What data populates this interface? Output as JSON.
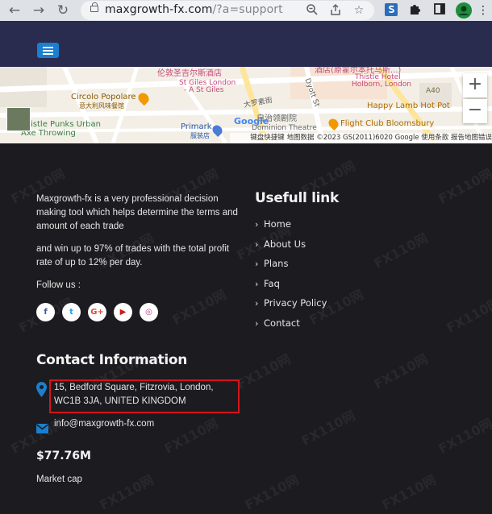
{
  "browser": {
    "url_host": "maxgrowth-fx.com",
    "url_rest": "/?a=support"
  },
  "map": {
    "labels": {
      "st_giles_cn": "伦敦圣吉尔斯酒店",
      "st_giles_en_1": "St Giles London",
      "st_giles_en_2": "- A St Giles",
      "circolo": "Circolo Popolare",
      "circolo_cn": "意大利风味餐馆",
      "punks_1": "istle Punks Urban",
      "punks_2": "Axe Throwing",
      "primark": "Primark",
      "primark_cn": "服装店",
      "rossell": "大罗素街",
      "dominion_cn": "自治领剧院",
      "dominion": "Dominion Theatre",
      "thistle_cn": "酒店(原霍尔本托马斯...)",
      "thistle_1": "Thistle Hotel",
      "thistle_2": "Holborn, London",
      "happy_lamb": "Happy Lamb Hot Pot",
      "flight_club": "Flight Club Bloomsbury",
      "dyott": "Dyott St",
      "a40": "A40",
      "google": "Google"
    },
    "footer_text": "键盘快捷键   地图数据 ©2023 GS(2011)6020 Google   使用条款   报告地图错误",
    "zoom_in": "+",
    "zoom_out": "−"
  },
  "footer": {
    "about_1": "Maxgrowth-fx is a very professional decision making tool which helps determine the terms and amount of each trade",
    "about_2": "and win up to 97% of trades with the total profit rate of up to 12% per day.",
    "follow_label": "Follow us :",
    "social": [
      {
        "name": "facebook",
        "glyph": "f",
        "color": "#3b5998"
      },
      {
        "name": "twitter",
        "glyph": "t",
        "color": "#1da1f2"
      },
      {
        "name": "google-plus",
        "glyph": "G+",
        "color": "#dd4b39"
      },
      {
        "name": "youtube",
        "glyph": "▶",
        "color": "#cc181e"
      },
      {
        "name": "instagram",
        "glyph": "◎",
        "color": "#c13584"
      }
    ],
    "useful_heading": "Usefull link",
    "links": [
      "Home",
      "About Us",
      "Plans",
      "Faq",
      "Privacy Policy",
      "Contact"
    ],
    "contact_heading": "Contact Information",
    "address": "15, Bedford Square, Fitzrovia, London, WC1B 3JA, UNITED KINGDOM",
    "email": "info@maxgrowth-fx.com",
    "market_cap_value": "$77.76M",
    "market_cap_label": "Market cap",
    "watermark": "FX110网"
  },
  "colors": {
    "header_bg": "#292c4f",
    "footer_bg": "#1c1b1f",
    "accent_blue": "#1a7fd0",
    "highlight_red": "#d4141b"
  }
}
